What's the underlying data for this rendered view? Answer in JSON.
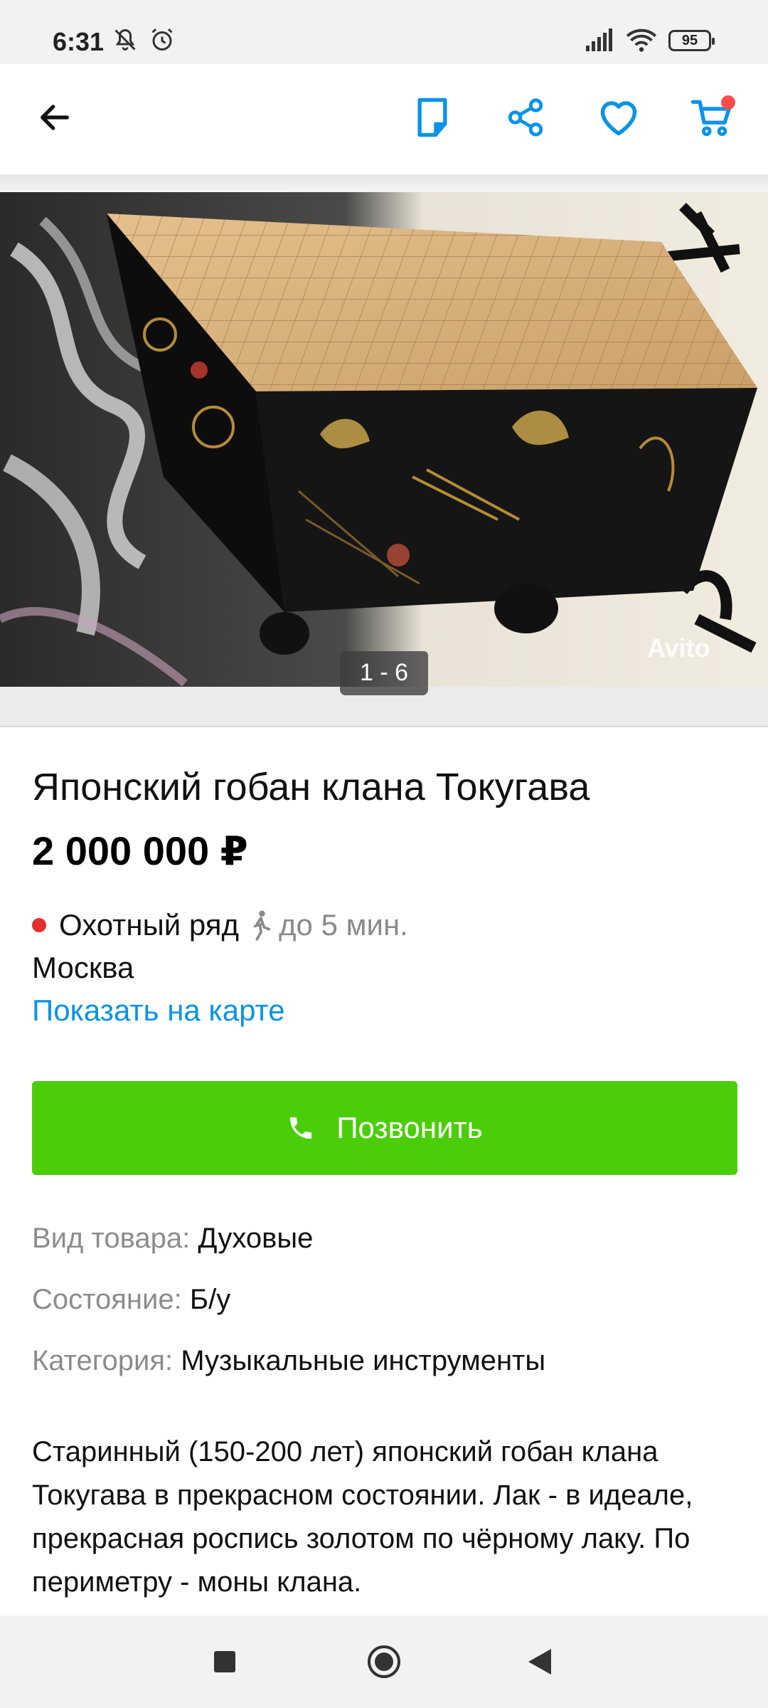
{
  "status_bar": {
    "time": "6:31",
    "battery": "95",
    "icons": [
      "mute-icon",
      "alarm-icon",
      "signal-icon",
      "wifi-icon",
      "battery-icon"
    ]
  },
  "app_bar": {
    "icons": [
      "back-arrow-icon",
      "note-icon",
      "share-icon",
      "heart-icon",
      "cart-icon"
    ],
    "accent_color": "#0a93e6",
    "cart_badge_color": "#ff4d4d"
  },
  "gallery": {
    "counter": "1 - 6",
    "watermark": "Avito"
  },
  "listing": {
    "title": "Японский гобан клана Токугава",
    "price": "2 000 000 ₽",
    "metro": {
      "station": "Охотный ряд",
      "walk_time": "до 5 мин.",
      "line_color": "#e32f2f"
    },
    "city": "Москва",
    "map_link": "Показать на карте",
    "call_button": "Позвонить",
    "call_button_color": "#4ccd09"
  },
  "params": [
    {
      "key": "Вид товара:",
      "value": "Духовые"
    },
    {
      "key": "Состояние:",
      "value": "Б/у"
    },
    {
      "key": "Категория:",
      "value": "Музыкальные инструменты"
    }
  ],
  "description": "Старинный (150-200 лет) японский гобан клана Токугава в прекрасном состоянии. Лак - в идеале, прекрасная роспись золотом по чёрному лаку. По периметру - моны клана.",
  "nav_bar": {
    "icons": [
      "recents-square-icon",
      "home-circle-icon",
      "back-triangle-icon"
    ]
  }
}
